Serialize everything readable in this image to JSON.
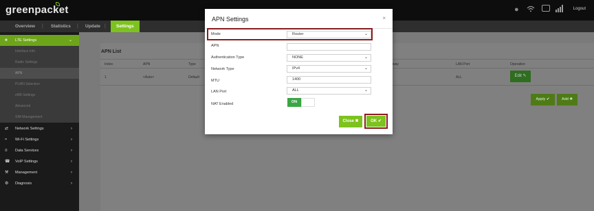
{
  "header": {
    "logo": "greenpacket",
    "logout": "Logout",
    "icons": [
      "bulb-icon",
      "wifi-icon",
      "battery-icon",
      "signal-icon"
    ]
  },
  "nav": {
    "overview": "Overview",
    "statistics": "Statistics",
    "update": "Update",
    "settings": "Settings",
    "sep": "|"
  },
  "sidebar": {
    "lte": "LTE Settings",
    "sub": [
      "Interface Info",
      "Radio Settings",
      "APN",
      "PLMN Selection",
      "eNB Settings",
      "Advanced",
      "SIM Management"
    ],
    "network": "Network Settings",
    "wifi": "Wi-Fi Settings",
    "data": "Data Services",
    "voip": "VoIP Settings",
    "management": "Management",
    "diagnosis": "Diagnosis"
  },
  "apn_list": {
    "title": "APN List",
    "headers": {
      "index": "Index",
      "apn": "APN",
      "type": "Type",
      "gateway": "way",
      "lan_port": "LAN Port",
      "operation": "Operation"
    },
    "row": {
      "index": "1",
      "apn": "<Auto>",
      "type": "Default",
      "lan_port": "ALL"
    },
    "edit": "Edit",
    "apply": "Apply",
    "add": "Add"
  },
  "modal": {
    "title": "APN Settings",
    "close_x": "×",
    "labels": {
      "mode": "Mode",
      "apn": "APN",
      "auth": "Authentication Type",
      "network": "Network Type",
      "mtu": "MTU",
      "lan": "LAN Port",
      "nat": "NAT Enabled"
    },
    "values": {
      "mode": "Router",
      "apn": "",
      "auth": "NONE",
      "network": "IPv4",
      "mtu": "1400",
      "lan": "ALL"
    },
    "nat_on": "ON",
    "close_btn": "Close",
    "ok_btn": "OK"
  },
  "colors": {
    "accent": "#7dc21e",
    "highlight": "#8b1a1a"
  }
}
